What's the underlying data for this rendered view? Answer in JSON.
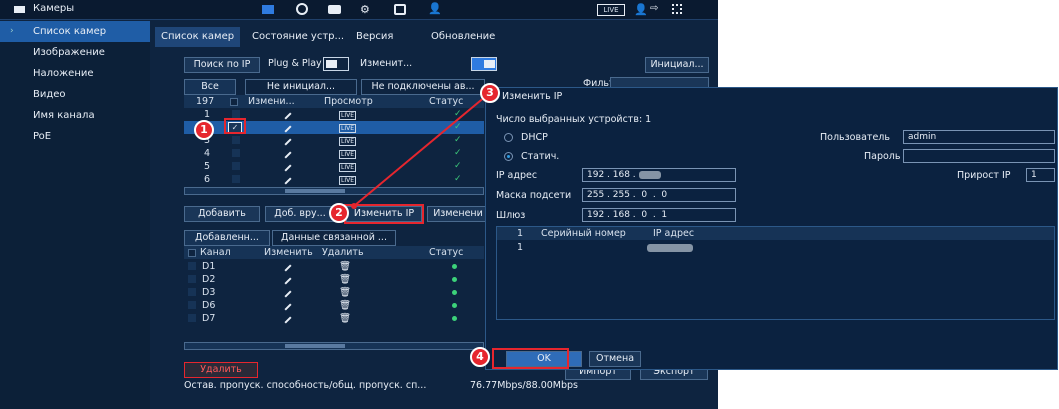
{
  "top_bar": {
    "title": "Камеры",
    "live_badge": "LIVE"
  },
  "sidebar": {
    "items": [
      {
        "label": "Список камер",
        "active": true
      },
      {
        "label": "Изображение"
      },
      {
        "label": "Наложение"
      },
      {
        "label": "Видео"
      },
      {
        "label": "Имя канала"
      },
      {
        "label": "PoE"
      }
    ]
  },
  "tabs": [
    "Список камер",
    "Состояние устр...",
    "Версия",
    "Обновление"
  ],
  "toolbar": {
    "search_ip": "Поиск по IP",
    "plug_play": "Plug & Play",
    "change": "Изменит...",
    "init": "Инициал...",
    "filter": "Фильтр"
  },
  "filter_tabs": [
    "Все",
    "Не инициал...",
    "Не подключены ав..."
  ],
  "device_table": {
    "count": "197",
    "headers": [
      "Измени...",
      "Просмотр",
      "Статус"
    ],
    "rows": [
      "1",
      "2",
      "3",
      "4",
      "5",
      "6"
    ],
    "live": "LIVE"
  },
  "actions": {
    "add": "Добавить",
    "add_manual": "Доб. вру...",
    "change_ip": "Изменить IP",
    "change_other": "Изменени"
  },
  "added_tabs": [
    "Добавленн...",
    "Данные связанной ..."
  ],
  "added_table": {
    "headers": [
      "Канал",
      "Изменить",
      "Удалить",
      "Статус"
    ],
    "rows": [
      "D1",
      "D2",
      "D3",
      "D6",
      "D7"
    ]
  },
  "delete_label": "Удалить",
  "import_label": "Импорт",
  "export_label": "Экспорт",
  "bandwidth_label": "Остав. пропуск. способность/общ. пропуск. сп...",
  "bandwidth_value": "76.77Mbps/88.00Mbps",
  "dialog": {
    "title": "Изменить IP",
    "selected_count": "Число выбранных устройств: 1",
    "dhcp": "DHCP",
    "static": "Статич.",
    "user_label": "Пользователь",
    "user_value": "admin",
    "password_label": "Пароль",
    "ip_label": "IP адрес",
    "ip_value": "192 . 168 .",
    "mask_label": "Маска подсети",
    "mask_value": "255 . 255 .  0  .  0",
    "gateway_label": "Шлюз",
    "gateway_value": "192 . 168 .  0  .  1",
    "increment_label": "Прирост IP",
    "increment_value": "1",
    "table_headers": [
      "1",
      "Серийный номер",
      "IP адрес"
    ],
    "table_row": "1",
    "ok": "OK",
    "cancel": "Отмена"
  },
  "callouts": [
    "1",
    "2",
    "3",
    "4"
  ],
  "colors": {
    "accent": "#1f5da6",
    "callout": "#e6262e",
    "status_ok": "#3cd27a"
  }
}
